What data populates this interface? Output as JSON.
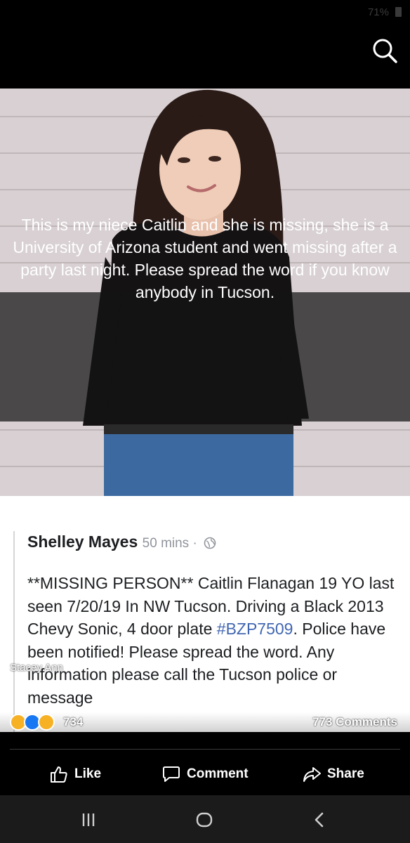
{
  "status_bar": {
    "battery": "71%"
  },
  "top_bar": {
    "search_icon": "search-icon"
  },
  "photo": {
    "description_icon": "photo-of-person",
    "caption": "This is my niece Caitlin and she is missing, she is a University of Arizona student and went missing after a party last night.  Please spread the word if you know anybody in Tucson."
  },
  "post": {
    "author": "Shelley Mayes",
    "time": "50 mins",
    "separator": " · ",
    "audience_icon": "globe-icon",
    "body_part1": "**MISSING PERSON** Caitlin Flanagan 19 YO last seen 7/20/19 In NW Tucson. Driving a Black 2013 Chevy Sonic, 4 door plate ",
    "hashtag": "#BZP7509",
    "body_part2": ". Police have been notified! Please spread the word. Any information please call the Tucson police or message"
  },
  "overlay": {
    "sharer_name": "Stacey Ann",
    "reaction_count": "734",
    "comments": "773 Comments",
    "reaction_icons": [
      "sad-reaction-icon",
      "like-reaction-icon",
      "wow-reaction-icon"
    ]
  },
  "actions": {
    "like": "Like",
    "comment": "Comment",
    "share": "Share"
  },
  "nav": {
    "recents_icon": "recents-icon",
    "home_icon": "home-icon",
    "back_icon": "back-icon"
  },
  "colors": {
    "hashtag": "#4267b2",
    "background": "#000000",
    "post_bg": "#ffffff"
  }
}
